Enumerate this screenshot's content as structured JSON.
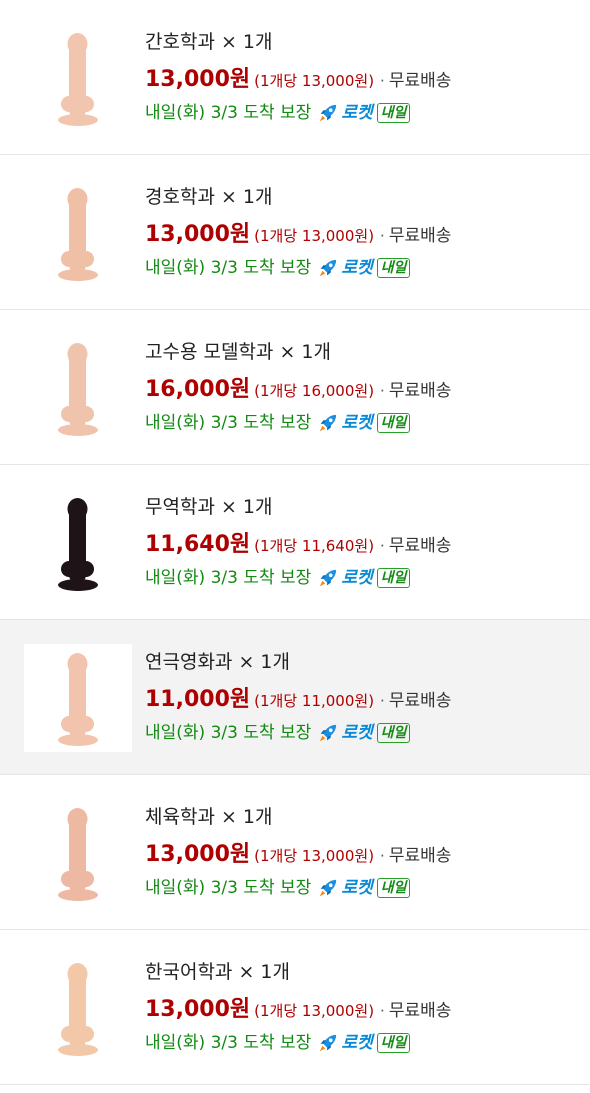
{
  "colors": {
    "price": "#ae0000",
    "delivery": "#138a13",
    "rocket": "#0a8ad6",
    "highlight_bg": "#f3f3f3"
  },
  "items": [
    {
      "title": "간호학과 × 1개",
      "price": "13,000원",
      "unit_price": "(1개당 13,000원)",
      "shipping": "무료배송",
      "delivery": "내일(화) 3/3 도착 보장",
      "rocket_label": "로켓",
      "badge": "내일",
      "icon": "rocket-icon",
      "highlight": false,
      "product_color": "#f2c5ae"
    },
    {
      "title": "경호학과 × 1개",
      "price": "13,000원",
      "unit_price": "(1개당 13,000원)",
      "shipping": "무료배송",
      "delivery": "내일(화) 3/3 도착 보장",
      "rocket_label": "로켓",
      "badge": "내일",
      "icon": "rocket-icon",
      "highlight": false,
      "product_color": "#efbfa6"
    },
    {
      "title": "고수용 모델학과 × 1개",
      "price": "16,000원",
      "unit_price": "(1개당 16,000원)",
      "shipping": "무료배송",
      "delivery": "내일(화) 3/3 도착 보장",
      "rocket_label": "로켓",
      "badge": "내일",
      "icon": "rocket-icon",
      "highlight": false,
      "product_color": "#f0c3ad"
    },
    {
      "title": "무역학과 × 1개",
      "price": "11,640원",
      "unit_price": "(1개당 11,640원)",
      "shipping": "무료배송",
      "delivery": "내일(화) 3/3 도착 보장",
      "rocket_label": "로켓",
      "badge": "내일",
      "icon": "rocket-icon",
      "highlight": false,
      "product_color": "#1e1418"
    },
    {
      "title": "연극영화과 × 1개",
      "price": "11,000원",
      "unit_price": "(1개당 11,000원)",
      "shipping": "무료배송",
      "delivery": "내일(화) 3/3 도착 보장",
      "rocket_label": "로켓",
      "badge": "내일",
      "icon": "rocket-icon",
      "highlight": true,
      "product_color": "#f2c4ad"
    },
    {
      "title": "체육학과 × 1개",
      "price": "13,000원",
      "unit_price": "(1개당 13,000원)",
      "shipping": "무료배송",
      "delivery": "내일(화) 3/3 도착 보장",
      "rocket_label": "로켓",
      "badge": "내일",
      "icon": "rocket-icon",
      "highlight": false,
      "product_color": "#eeb9a2"
    },
    {
      "title": "한국어학과 × 1개",
      "price": "13,000원",
      "unit_price": "(1개당 13,000원)",
      "shipping": "무료배송",
      "delivery": "내일(화) 3/3 도착 보장",
      "rocket_label": "로켓",
      "badge": "내일",
      "icon": "rocket-icon",
      "highlight": false,
      "product_color": "#f3c8a8"
    }
  ]
}
